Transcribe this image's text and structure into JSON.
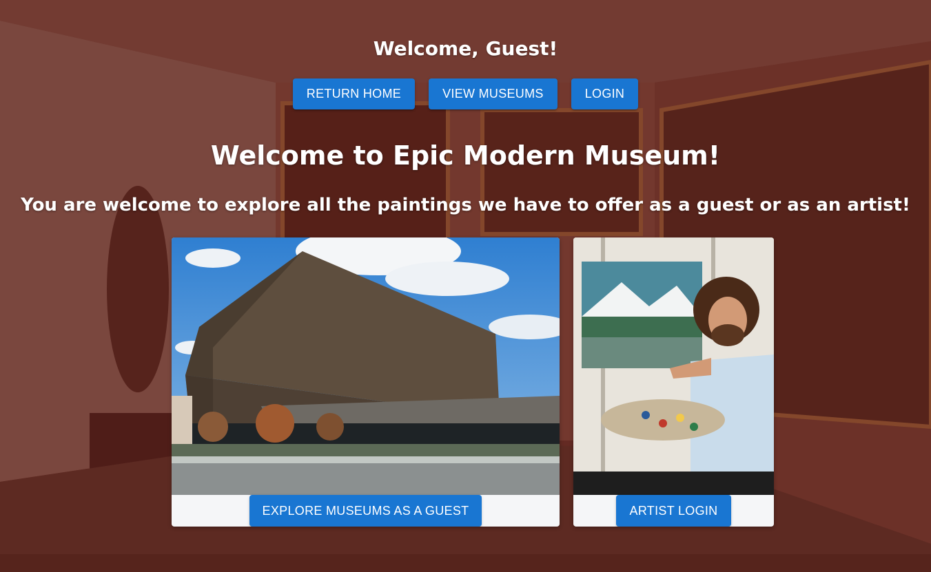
{
  "header": {
    "greeting": "Welcome, Guest!"
  },
  "nav": {
    "return_home": "RETURN HOME",
    "view_museums": "VIEW MUSEUMS",
    "login": "LOGIN"
  },
  "main": {
    "title": "Welcome to Epic Modern Museum!",
    "subtitle": "You are welcome to explore all the paintings we have to offer as a guest or as an artist!"
  },
  "cards": {
    "guest": {
      "button_label": "EXPLORE MUSEUMS AS A GUEST"
    },
    "artist": {
      "button_label": "ARTIST LOGIN"
    }
  },
  "colors": {
    "primary_button": "#1976d2",
    "overlay": "#6e1e19",
    "card_background": "#f5f6f8"
  }
}
